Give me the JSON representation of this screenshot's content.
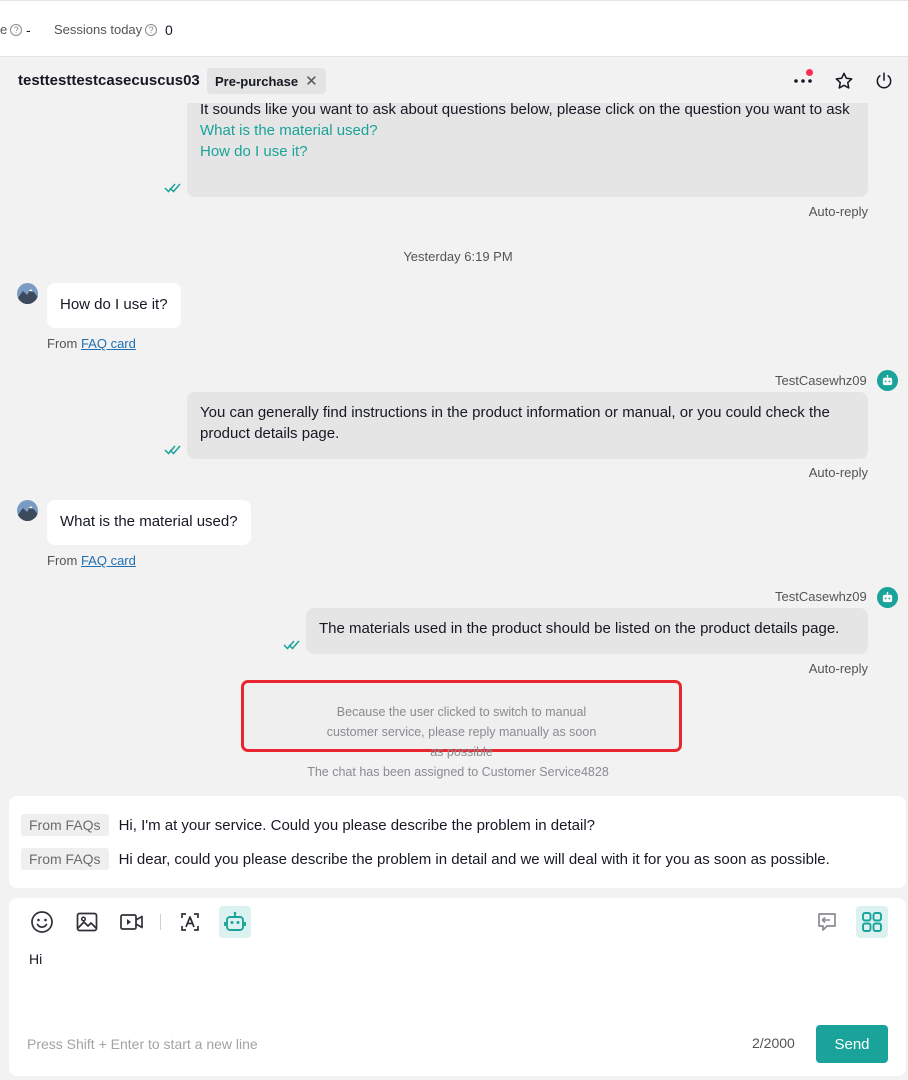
{
  "stats": {
    "cut_label": "e",
    "cut_value": "-",
    "sessions_label": "Sessions today",
    "sessions_value": "0"
  },
  "chat": {
    "customer_name": "testtesttestcasecuscus03",
    "tag_label": "Pre-purchase"
  },
  "messages": {
    "m1": {
      "text": "It sounds like you want to ask about questions below, please click on the question you want to ask",
      "questions": [
        "What is the material used?",
        "How do I use it?"
      ],
      "status": "Auto-reply"
    },
    "timestamp": "Yesterday 6:19 PM",
    "m2": {
      "text": "How do I use it?",
      "from_prefix": "From ",
      "from_link": "FAQ card"
    },
    "m3": {
      "agent": "TestCasewhz09",
      "text": "You can generally find instructions in the product information or manual, or you could check the product details page.",
      "status": "Auto-reply"
    },
    "m4": {
      "text": "What is the material used?",
      "from_prefix": "From ",
      "from_link": "FAQ card"
    },
    "m5": {
      "agent": "TestCasewhz09",
      "text": "The materials used in the product should be listed on the product details page.",
      "status": "Auto-reply"
    },
    "system_notice": "Because the user clicked to switch to manual customer service, please reply manually as soon as possible",
    "assigned_notice": "The chat has been assigned to Customer Service4828"
  },
  "faq": [
    {
      "tag": "From FAQs",
      "text": "Hi, I'm at your service. Could you please describe the problem in detail?"
    },
    {
      "tag": "From FAQs",
      "text": "Hi dear, could you please describe the problem in detail and we will deal with it for you as soon as possible."
    }
  ],
  "editor": {
    "value": "Hi",
    "placeholder": "Press Shift + Enter to start a new line",
    "counter": "2/2000",
    "send_label": "Send"
  },
  "colors": {
    "accent": "#1aa39a",
    "highlight_border": "#e8262f",
    "notification_dot": "#fe2c55"
  },
  "icons": {
    "toolbar": [
      "emoji-icon",
      "image-icon",
      "video-icon",
      "translate-icon",
      "robot-icon"
    ],
    "toolbar_right": [
      "reply-icon",
      "grid-icon"
    ],
    "header": [
      "more-icon",
      "star-icon",
      "power-icon"
    ]
  }
}
